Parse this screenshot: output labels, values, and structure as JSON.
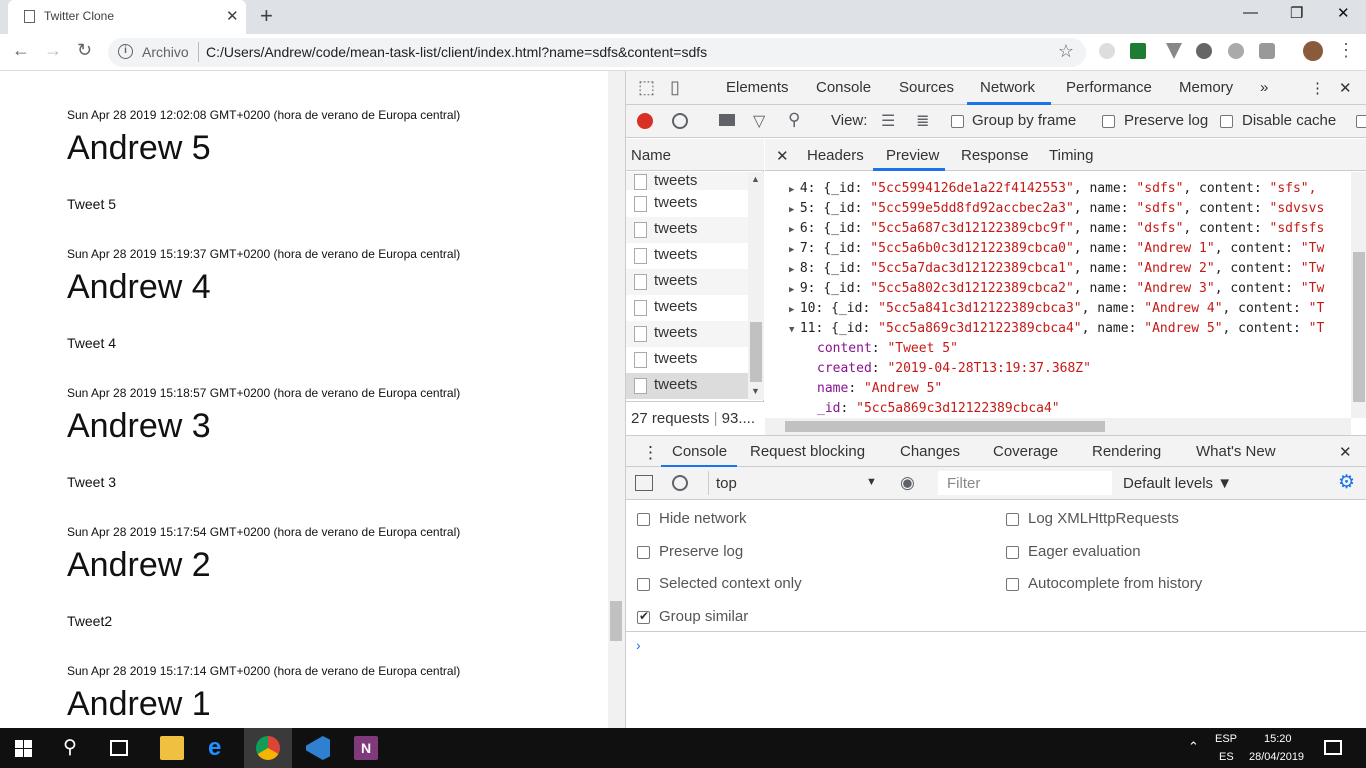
{
  "browser": {
    "tab_title": "Twitter Clone",
    "scheme_label": "Archivo",
    "url": "C:/Users/Andrew/code/mean-task-list/client/index.html?name=sdfs&content=sdfs",
    "icons": {
      "tab_close": "✕",
      "new_tab": "+",
      "minimize": "—",
      "maximize": "❐",
      "close": "✕",
      "back": "←",
      "forward": "→",
      "reload": "↻",
      "star": "☆",
      "more": "⋮",
      "info": "i"
    }
  },
  "tweets": [
    {
      "date": "Sun Apr 28 2019 12:02:08 GMT+0200 (hora de verano de Europa central)",
      "name": "Andrew 5",
      "content": "Tweet 5"
    },
    {
      "date": "Sun Apr 28 2019 15:19:37 GMT+0200 (hora de verano de Europa central)",
      "name": "Andrew 4",
      "content": "Tweet 4"
    },
    {
      "date": "Sun Apr 28 2019 15:18:57 GMT+0200 (hora de verano de Europa central)",
      "name": "Andrew 3",
      "content": "Tweet 3"
    },
    {
      "date": "Sun Apr 28 2019 15:17:54 GMT+0200 (hora de verano de Europa central)",
      "name": "Andrew 2",
      "content": "Tweet2"
    },
    {
      "date": "Sun Apr 28 2019 15:17:14 GMT+0200 (hora de verano de Europa central)",
      "name": "Andrew 1",
      "content": ""
    }
  ],
  "devtools": {
    "tabs": [
      "Elements",
      "Console",
      "Sources",
      "Network",
      "Performance",
      "Memory"
    ],
    "active_tab": "Network",
    "more_tabs": "»",
    "menu": "⋮",
    "close": "✕",
    "network_toolbar": {
      "view_label": "View:",
      "group_by_frame": "Group by frame",
      "preserve_log": "Preserve log",
      "disable_cache": "Disable cache"
    },
    "name_header": "Name",
    "requests": [
      "tweets",
      "tweets",
      "tweets",
      "tweets",
      "tweets",
      "tweets",
      "tweets",
      "tweets",
      "tweets"
    ],
    "status": "27 requests",
    "status_extra": "93....",
    "detail_tabs": [
      "Headers",
      "Preview",
      "Response",
      "Timing"
    ],
    "active_detail_tab": "Preview",
    "detail_close": "✕",
    "preview_rows": [
      {
        "idx": "4",
        "id": "5cc5994126de1a22f4142553",
        "name": "sdfs",
        "content": "sfs\","
      },
      {
        "idx": "5",
        "id": "5cc599e5dd8fd92accbec2a3",
        "name": "sdfs",
        "content": "sdvsvs"
      },
      {
        "idx": "6",
        "id": "5cc5a687c3d12122389cbc9f",
        "name": "dsfs",
        "content": "sdfsfs"
      },
      {
        "idx": "7",
        "id": "5cc5a6b0c3d12122389cbca0",
        "name": "Andrew 1",
        "content": "Tw"
      },
      {
        "idx": "8",
        "id": "5cc5a7dac3d12122389cbca1",
        "name": "Andrew 2",
        "content": "Tw"
      },
      {
        "idx": "9",
        "id": "5cc5a802c3d12122389cbca2",
        "name": "Andrew 3",
        "content": "Tw"
      },
      {
        "idx": "10",
        "id": "5cc5a841c3d12122389cbca3",
        "name": "Andrew 4",
        "content": "T"
      },
      {
        "idx": "11",
        "id": "5cc5a869c3d12122389cbca4",
        "name": "Andrew 5",
        "content": "T"
      }
    ],
    "expanded": {
      "content": "\"Tweet 5\"",
      "created": "\"2019-04-28T13:19:37.368Z\"",
      "name": "\"Andrew 5\"",
      "_id": "\"5cc5a869c3d12122389cbca4\""
    },
    "drawer_tabs": [
      "Console",
      "Request blocking",
      "Changes",
      "Coverage",
      "Rendering",
      "What's New"
    ],
    "active_drawer_tab": "Console",
    "console_toolbar": {
      "context": "top",
      "filter_placeholder": "Filter",
      "levels": "Default levels ▼"
    },
    "settings": [
      {
        "label": "Hide network",
        "checked": false
      },
      {
        "label": "Log XMLHttpRequests",
        "checked": false
      },
      {
        "label": "Preserve log",
        "checked": false
      },
      {
        "label": "Eager evaluation",
        "checked": false
      },
      {
        "label": "Selected context only",
        "checked": false
      },
      {
        "label": "Autocomplete from history",
        "checked": false
      },
      {
        "label": "Group similar",
        "checked": true
      }
    ],
    "prompt": "›"
  },
  "taskbar": {
    "lang_top": "ESP",
    "lang_bottom": "ES",
    "time": "15:20",
    "date": "28/04/2019"
  },
  "colors": {
    "record_red": "#d93025",
    "active_tab_blue": "#1a73e8",
    "key_purple": "#881391",
    "string_red": "#c41a16"
  }
}
